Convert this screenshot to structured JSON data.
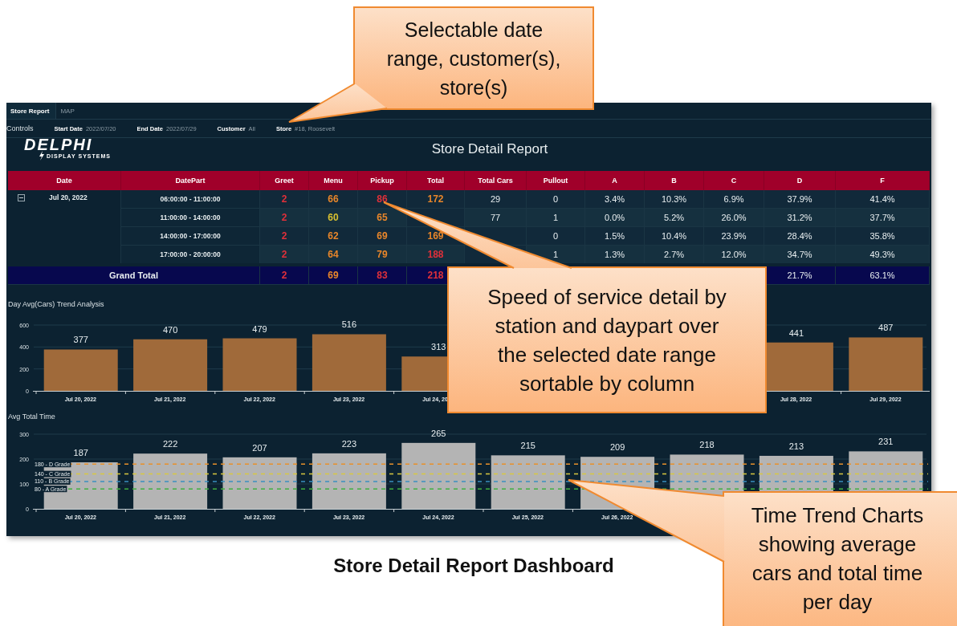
{
  "tabs": [
    {
      "label": "Store Report",
      "selected": true
    },
    {
      "label": "MAP",
      "selected": false
    }
  ],
  "controls": {
    "label": "Controls",
    "filters": [
      {
        "label": "Start Date",
        "value": "2022/07/20"
      },
      {
        "label": "End Date",
        "value": "2022/07/29"
      },
      {
        "label": "Customer",
        "value": "All"
      },
      {
        "label": "Store",
        "value": "#18, Roosevelt"
      }
    ]
  },
  "logo": {
    "name": "DELPHI",
    "tagline": "DISPLAY SYSTEMS"
  },
  "report_title": "Store Detail Report",
  "table": {
    "columns": [
      "Date",
      "DatePart",
      "Greet",
      "Menu",
      "Pickup",
      "Total",
      "Total Cars",
      "Pullout",
      "A",
      "B",
      "C",
      "D",
      "F"
    ],
    "groups": [
      {
        "date": "Jul 20, 2022",
        "expanded": true,
        "rows": [
          {
            "daypart": "06:00:00 - 11:00:00",
            "cells": [
              {
                "text": "2",
                "color": "#e0303a"
              },
              {
                "text": "66",
                "color": "#e8862a"
              },
              {
                "text": "86",
                "color": "#e0303a"
              },
              {
                "text": "172",
                "color": "#e8862a"
              },
              "29",
              "0",
              "3.4%",
              "10.3%",
              "6.9%",
              "37.9%",
              "41.4%"
            ]
          },
          {
            "daypart": "11:00:00 - 14:00:00",
            "cells": [
              {
                "text": "2",
                "color": "#e0303a"
              },
              {
                "text": "60",
                "color": "#d8c030"
              },
              {
                "text": "65",
                "color": "#e8862a"
              },
              null,
              "77",
              "1",
              "0.0%",
              "5.2%",
              "26.0%",
              "31.2%",
              "37.7%"
            ]
          },
          {
            "daypart": "14:00:00 - 17:00:00",
            "cells": [
              {
                "text": "2",
                "color": "#e0303a"
              },
              {
                "text": "62",
                "color": "#e8862a"
              },
              {
                "text": "69",
                "color": "#e8862a"
              },
              {
                "text": "169",
                "color": "#e8862a"
              },
              null,
              "0",
              "1.5%",
              "10.4%",
              "23.9%",
              "28.4%",
              "35.8%"
            ]
          },
          {
            "daypart": "17:00:00 - 20:00:00",
            "cells": [
              {
                "text": "2",
                "color": "#e0303a"
              },
              {
                "text": "64",
                "color": "#e8862a"
              },
              {
                "text": "79",
                "color": "#e8862a"
              },
              {
                "text": "188",
                "color": "#e0303a"
              },
              null,
              "1",
              "1.3%",
              "2.7%",
              "12.0%",
              "34.7%",
              "49.3%"
            ]
          }
        ]
      }
    ],
    "grand_total": {
      "label": "Grand Total",
      "cells": [
        {
          "text": "2",
          "color": "#e0303a"
        },
        {
          "text": "69",
          "color": "#e8862a"
        },
        {
          "text": "83",
          "color": "#e0303a"
        },
        {
          "text": "218",
          "color": "#e0303a"
        },
        null,
        null,
        null,
        null,
        null,
        "21.7%",
        "63.1%"
      ]
    }
  },
  "charts": [
    {
      "title": "Day Avg(Cars) Trend Analysis",
      "chart_data": {
        "type": "bar",
        "categories": [
          "Jul 20, 2022",
          "Jul 21, 2022",
          "Jul 22, 2022",
          "Jul 23, 2022",
          "Jul 24, 20",
          null,
          null,
          null,
          "Jul 28, 2022",
          "Jul 29, 2022"
        ],
        "values": [
          377,
          470,
          479,
          516,
          313,
          null,
          null,
          null,
          441,
          487
        ],
        "ylim": [
          0,
          600
        ],
        "yticks": [
          0,
          200,
          400,
          600
        ],
        "data_labels": true
      }
    },
    {
      "title": "Avg Total Time",
      "chart_data": {
        "type": "bar",
        "categories": [
          "Jul 20, 2022",
          "Jul 21, 2022",
          "Jul 22, 2022",
          "Jul 23, 2022",
          "Jul 24, 2022",
          "Jul 25, 2022",
          "Jul 26, 2022",
          null,
          null,
          null
        ],
        "values": [
          187,
          222,
          207,
          223,
          265,
          215,
          209,
          218,
          213,
          231
        ],
        "ylim": [
          0,
          300
        ],
        "yticks": [
          0,
          100,
          200,
          300
        ],
        "data_labels": true,
        "ref_lines": [
          {
            "axis": "y",
            "value": 180,
            "label": "180 - D Grade",
            "color": "#e8902a"
          },
          {
            "axis": "y",
            "value": 140,
            "label": "140 - C Grade",
            "color": "#d8c840"
          },
          {
            "axis": "y",
            "value": 110,
            "label": "110 - B Grade",
            "color": "#3a90c0"
          },
          {
            "axis": "y",
            "value": 80,
            "label": "80 - A Grade",
            "color": "#40b040"
          }
        ]
      }
    }
  ],
  "callouts": [
    "Selectable date range, customer(s), store(s)",
    "Speed of service detail by station and daypart over the selected date range sortable by column",
    "Time Trend Charts showing average cars and total time per day"
  ],
  "caption": "Store Detail Report Dashboard"
}
